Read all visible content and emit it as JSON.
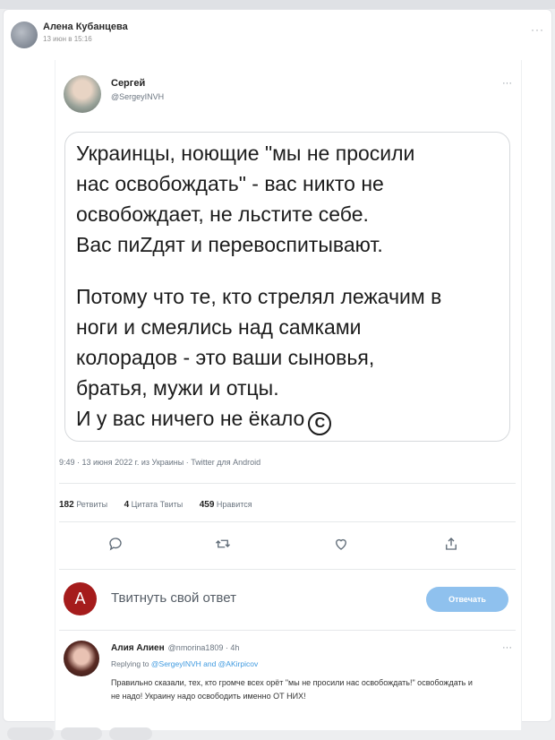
{
  "post": {
    "author": "Алена Кубанцева",
    "date": "13 июн в 15:16",
    "menu": "···"
  },
  "tweet": {
    "name": "Сергей",
    "handle": "@SergeyINVH",
    "menu": "···",
    "quote_paragraph_1": "Украинцы, ноющие \"мы не просили\nнас освобождать\" - вас никто не\nосвобождает, не льстите себе.\nВас пиZдят и перевоспитывают.",
    "quote_paragraph_2": "Потому что те, кто стрелял лежачим в\nноги и смеялись над самками\nколорадов - это ваши сыновья,\nбратья, мужи и отцы.\nИ у вас ничего не ёкало",
    "copyright_symbol": "C",
    "meta": "9:49 · 13 июня 2022 г. из Украины · Twitter для Android",
    "stats": [
      {
        "count": "182",
        "label": "Ретвиты"
      },
      {
        "count": "4",
        "label": "Цитата Твиты"
      },
      {
        "count": "459",
        "label": "Нравится"
      }
    ],
    "actions": [
      "reply-icon",
      "retweet-icon",
      "like-icon",
      "share-icon"
    ]
  },
  "reply_box": {
    "avatar_letter": "A",
    "prompt": "Твитнуть свой ответ",
    "button": "Отвечать",
    "avatar_color": "#a51c1c",
    "button_color": "#8fc1ee"
  },
  "reply": {
    "name": "Алия Алиен",
    "handle_time": "@nmorina1809 · 4h",
    "menu": "···",
    "replying_prefix": "Replying to",
    "replying_links": "@SergeyINVH and @AKirpicov",
    "text": "Правильно сказали, тех, кто громче всех орёт \"мы не просили нас освобождать!\" освобождать и не надо! Украину надо освободить именно ОТ НИХ!"
  }
}
